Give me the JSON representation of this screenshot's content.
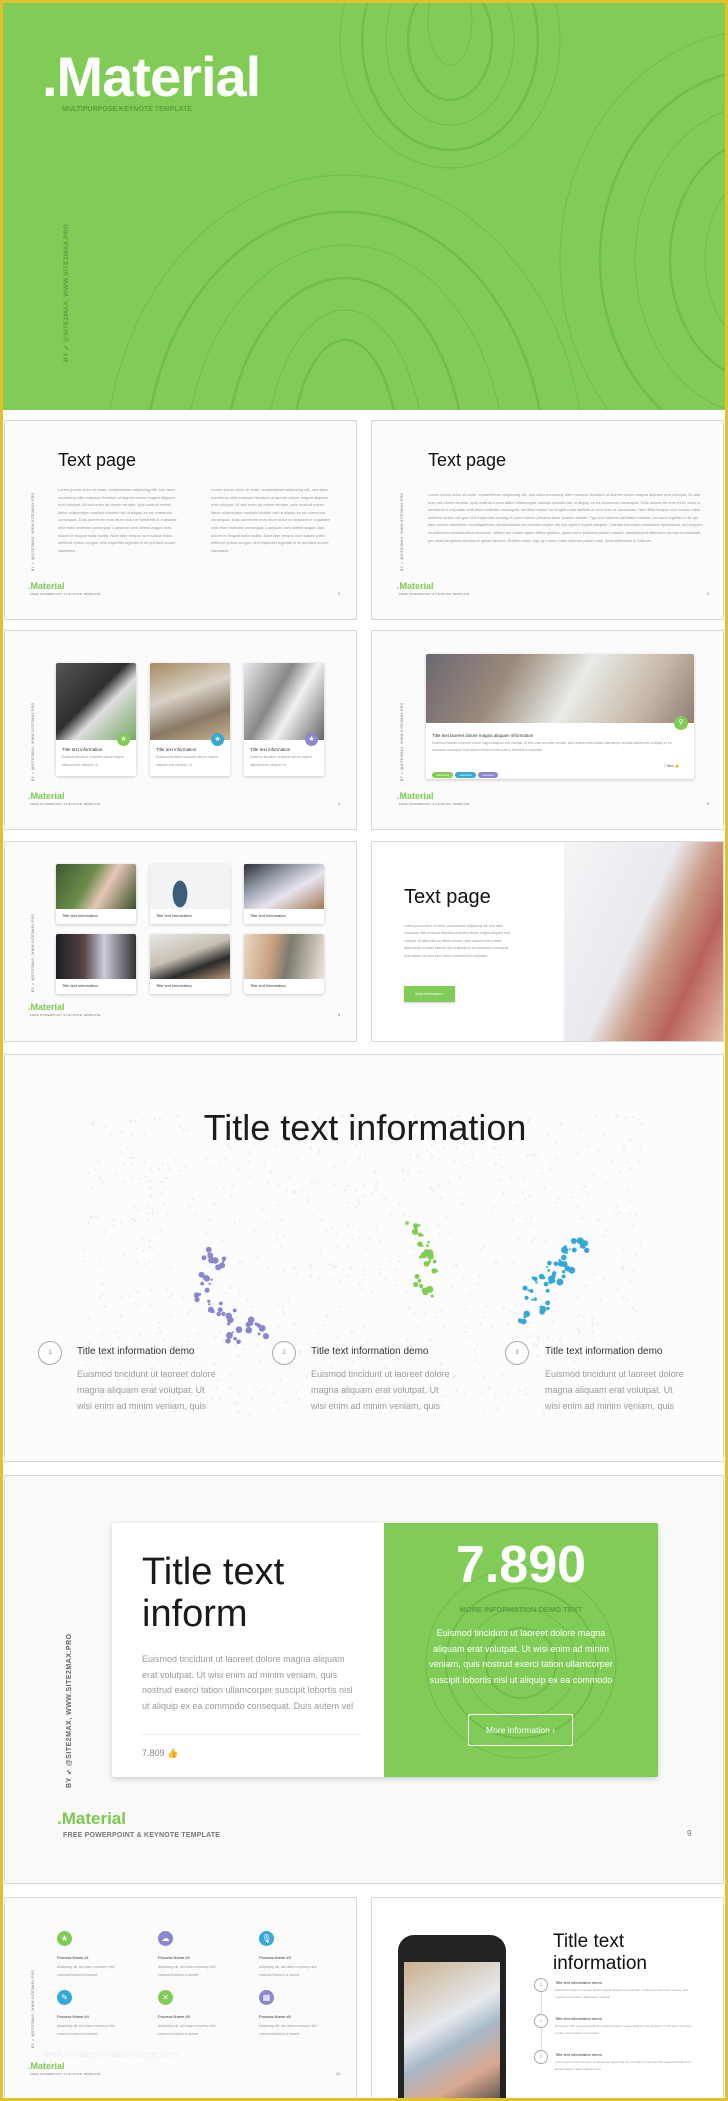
{
  "colors": {
    "green": "#80cc57",
    "purple": "#8a87cc",
    "blue": "#35a8d6",
    "frame": "#e2c12a"
  },
  "brand": {
    "name": ".Material",
    "tagline": "FREE POWERPOINT & KEYNOTE TEMPLATE",
    "side_label_by": "BY",
    "side_label": "@SITE2MAX, WWW.SITE2MAX.PRO",
    "bird_icon": "twitter-bird-icon"
  },
  "cover": {
    "title": ".Material",
    "subtitle": "MULTIPURPOSE KEYNOTE TEMPLATE"
  },
  "slide2": {
    "title": "Text page",
    "col1": "Lorem ipsum dolor sit amet, consectetuer adipiscing elit, sed diam nonummy nibh euismod tincidunt ut laoreet dolore magna aliquam erat volutpat. Ut wisi enim ad minim veniam, quis nostrud exerci tation ullamcorper suscipit lobortis nisl ut aliquip ex ea commodo consequat. Duis autem vel eum iriure dolor in hendrerit in vulputate velit esse molestie consequat. Luptatum zzril delenit augue duis dolore te feugait nulla facilisi. Nam liber tempor cum soluta nobis eleifend option congue nihil imperdiet legentis in iis qui facit eorum claritatem.",
    "col2": "Lorem ipsum dolor sit amet, consectetuer adipiscing elit, sed diam nonummy nibh euismod tincidunt ut laoreet dolore magna aliquam erat volutpat. Ut wisi enim ad minim veniam, quis nostrud exerci tation ullamcorper suscipit lobortis nisl ut aliquip ex ea commodo consequat. Duis autem vel eum iriure dolor in hendrerit in vulputate velit esse molestie consequat. Luptatum zzril delenit augue duis dolore te feugait nulla facilisi. Nam liber tempor cum soluta nobis eleifend option congue nihil imperdiet legentis in iis qui facit eorum claritatem.",
    "page": "2"
  },
  "slide3": {
    "title": "Text page",
    "body": "Lorem ipsum dolor sit amet, consectetuer adipiscing elit, sed diam nonummy nibh euismod tincidunt ut laoreet dolore magna aliquam erat volutpat. Ut wisi enim ad minim veniam, quis nostrud exerci tation ullamcorper suscipit lobortis nisl ut aliquip ex ea commodo consequat. Duis autem vel eum iriure dolor in hendrerit in vulputate velit esse molestie consequat, vel illum dolore eu feugiat nulla facilisis at vero eros et accumsan. Nam liber tempor cum soluta nobis eleifend option congue nihil imperdiet doming id quod mazim placerat facer possim assum. Typi non habent claritatem insitam; est usus legentis in iis qui facit eorum claritatem. Investigationes demonstraverunt lectores legere me lius quod ii legunt saepius. Claritas est etiam processus dynamicus, qui sequitur mutationem consuetudium lectorum. Mirum est notare quam littera gothica, quam nunc putamus parum claram, anteposuerit litterarum formas humanitatis per seacula quarta decima et quinta decima. Eodem modo typi, qui nunc nobis videntur parum clari, fiant sollemnes in futurum.",
    "page": "3"
  },
  "slide4": {
    "cards": [
      {
        "title": "Title text information",
        "desc": "Euismod tincidunt ut laoreet dolore magna aliquam erat volutpat. Ut",
        "badge": "star-icon"
      },
      {
        "title": "Title text information",
        "desc": "Euismod tincidunt ut laoreet dolore magna aliquam erat volutpat. Ut",
        "badge": "star-icon"
      },
      {
        "title": "Title text information",
        "desc": "Euismod tincidunt ut laoreet dolore magna aliquam erat volutpat. Ut",
        "badge": "star-icon"
      }
    ],
    "page": "4"
  },
  "slide5": {
    "title": "Title text laoreet dolore magna aliquam information",
    "desc": "Euismod tincidunt ut laoreet dolore magna aliquam erat volutpat. Ut wisi enim ad minim veniam, quis nostrud exerci tation ullamcorper suscipit lobortis nisl ut aliquip ex ea commodo consequat. Duis autem vel eum iriure dolor in hendrerit in vulputate.",
    "tags": [
      "marketing",
      "education",
      "business"
    ],
    "likes": "7 likes",
    "page": "5"
  },
  "slide6": {
    "cards": [
      "Title text information",
      "Title text information",
      "Title text information",
      "Title text information",
      "Title text information",
      "Title text information"
    ],
    "page": "6"
  },
  "slide7": {
    "title": "Text page",
    "body": "Lorem ipsum dolor sit amet, consectetuer adipiscing elit, sed diam nonummy nibh euismod tincidunt ut laoreet dolore magna aliquam erat volutpat. Ut wisi enim ad minim veniam, quis nostrud exerci tation ullamcorper suscipit lobortis nisl ut aliquip ex ea commodo consequat. Duis autem vel eum iriure dolor in hendrerit in vulputate.",
    "button": "More information ›"
  },
  "slide8": {
    "title": "Title text information",
    "items": [
      {
        "num": "1",
        "title": "Title text information demo",
        "desc": "Euismod tincidunt ut laoreet dolore magna aliquam erat volutpat. Ut wisi enim ad minim veniam, quis"
      },
      {
        "num": "2",
        "title": "Title text information demo",
        "desc": "Euismod tincidunt ut laoreet dolore magna aliquam erat volutpat. Ut wisi enim ad minim veniam, quis"
      },
      {
        "num": "3",
        "title": "Title text information demo",
        "desc": "Euismod tincidunt ut laoreet dolore magna aliquam erat volutpat. Ut wisi enim ad minim veniam, quis"
      }
    ]
  },
  "slide9": {
    "title_line1": "Title text",
    "title_line2": "inform",
    "desc": "Euismod tincidunt ut laoreet dolore magna aliquam erat volutpat. Ut wisi enim ad minim veniam, quis nostrud exerci tation ullamcorper suscipit lobortis nisl ut aliquip ex ea commodo consequat. Duis autem vel",
    "likes": "7.809",
    "stat": "7.890",
    "stat_label": "MORE INFORMATION DEMO TEXT",
    "stat_desc": "Euismod tincidunt ut laoreet dolore magna aliquam erat volutpat. Ut wisi enim ad minim veniam, quis nostrud exerci tation ullamcorper suscipit lobortis nisl ut aliquip ex ea commodo",
    "button": "More information ›",
    "page": "9"
  },
  "slide10": {
    "processes": [
      {
        "name": "Process Name #1",
        "desc": "Adipiscing elit, sed diam nonummy nibh euismod tincidunt ut laoreet",
        "icon": "star-icon"
      },
      {
        "name": "Process Name #2",
        "desc": "Adipiscing elit, sed diam nonummy nibh euismod tincidunt ut laoreet",
        "icon": "cloud-icon"
      },
      {
        "name": "Process Name #3",
        "desc": "Adipiscing elit, sed diam nonummy nibh euismod tincidunt ut laoreet",
        "icon": "microphone-icon"
      },
      {
        "name": "Process Name #4",
        "desc": "Adipiscing elit, sed diam nonummy nibh euismod tincidunt ut laoreet",
        "icon": "pencil-icon"
      },
      {
        "name": "Process Name #5",
        "desc": "Adipiscing elit, sed diam nonummy nibh euismod tincidunt ut laoreet",
        "icon": "tools-icon"
      },
      {
        "name": "Process Name #6",
        "desc": "Adipiscing elit, sed diam nonummy nibh euismod tincidunt ut laoreet",
        "icon": "calendar-icon"
      }
    ],
    "watermark": "www.heritagechristiancollege.com",
    "page": "10"
  },
  "slide11": {
    "title_line1": "Title text",
    "title_line2": "information",
    "items": [
      {
        "num": "1",
        "title": "Title text information demo",
        "desc": "Euismod tincidunt ut laoreet dolore magna aliquam erat volutpat. Ut wisi enim ad minim veniam, quis nostrud exerci tation ullamcorper suscipit"
      },
      {
        "num": "2",
        "title": "Title text information demo",
        "desc": "Nonummy nibh euismod tincidunt ut laoreet dolore magna aliquam erat volutpat. Ut wisi enim ad minim veniam, quis nostrud exerci tation"
      },
      {
        "num": "3",
        "title": "Title text information demo",
        "desc": "Lorem ipsum dolor sit amet, consectetuer adipiscing elit, sed diam nonummy nibh euismod tincidunt ut laoreet dolore magna aliquam erat"
      }
    ]
  }
}
